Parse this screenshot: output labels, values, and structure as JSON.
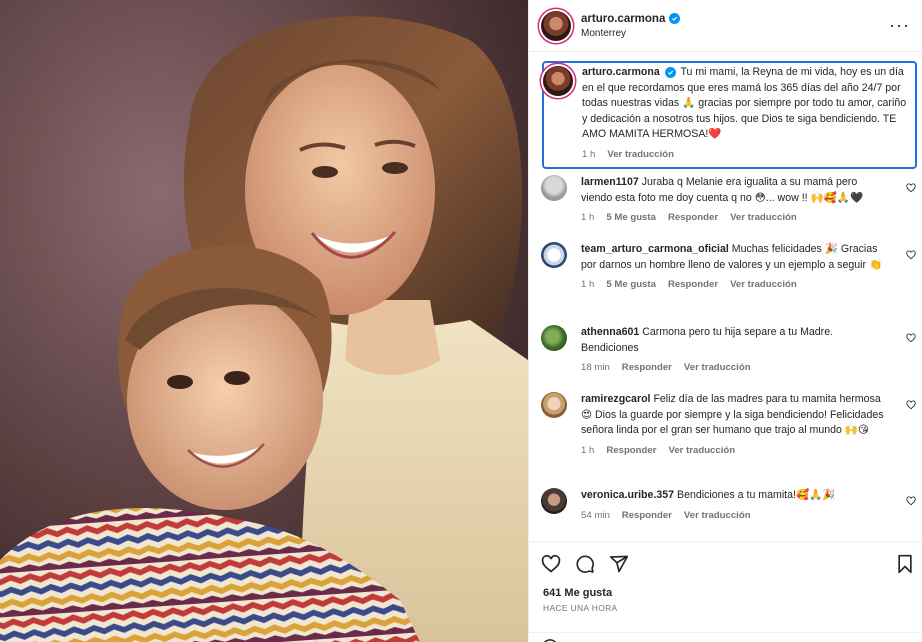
{
  "post": {
    "username": "arturo.carmona",
    "location": "Monterrey"
  },
  "caption": {
    "username": "arturo.carmona",
    "text": "Tu mi mami, la Reyna de mi vida, hoy es un día en el que recordamos que eres mamá los 365 días del año 24/7 por todas nuestras vidas 🙏 gracias por siempre por todo tu amor, cariño y dedicación a nosotros tus hijos. que Dios te siga bendiciendo. TE AMO MAMITA HERMOSA!❤️",
    "time": "1 h",
    "translate": "Ver traducción"
  },
  "comments": [
    {
      "username": "larmen1107",
      "text": "Juraba q Melanie era igualita a su mamá pero viendo esta foto me doy cuenta q no 😳... wow !! 🙌🥰🙏🖤",
      "time": "1 h",
      "likes": "5 Me gusta",
      "reply": "Responder",
      "translate": "Ver traducción"
    },
    {
      "username": "team_arturo_carmona_oficial",
      "text": "Muchas felicidades 🎉 Gracias por darnos un hombre lleno de valores y un ejemplo a seguir 👏",
      "time": "1 h",
      "likes": "5 Me gusta",
      "reply": "Responder",
      "translate": "Ver traducción"
    },
    {
      "username": "athenna601",
      "text": "Carmona pero tu hija separe a tu Madre. Bendiciones",
      "time": "18 min",
      "reply": "Responder",
      "translate": "Ver traducción"
    },
    {
      "username": "ramirezgcarol",
      "text": "Feliz día de las madres para tu mamita hermosa 😍 Dios la guarde por siempre y la siga bendiciendo! Felicidades señora linda por el gran ser humano que trajo al mundo 🙌😘",
      "time": "1 h",
      "reply": "Responder",
      "translate": "Ver traducción"
    },
    {
      "username": "veronica.uribe.357",
      "text": "Bendiciones a tu mamita!🥰🙏🎉",
      "time": "54 min",
      "reply": "Responder",
      "translate": "Ver traducción"
    }
  ],
  "footer": {
    "likes": "641 Me gusta",
    "posted": "HACE UNA HORA"
  },
  "colors": {
    "accent": "#0095f6",
    "focus": "#1f6fe0"
  }
}
